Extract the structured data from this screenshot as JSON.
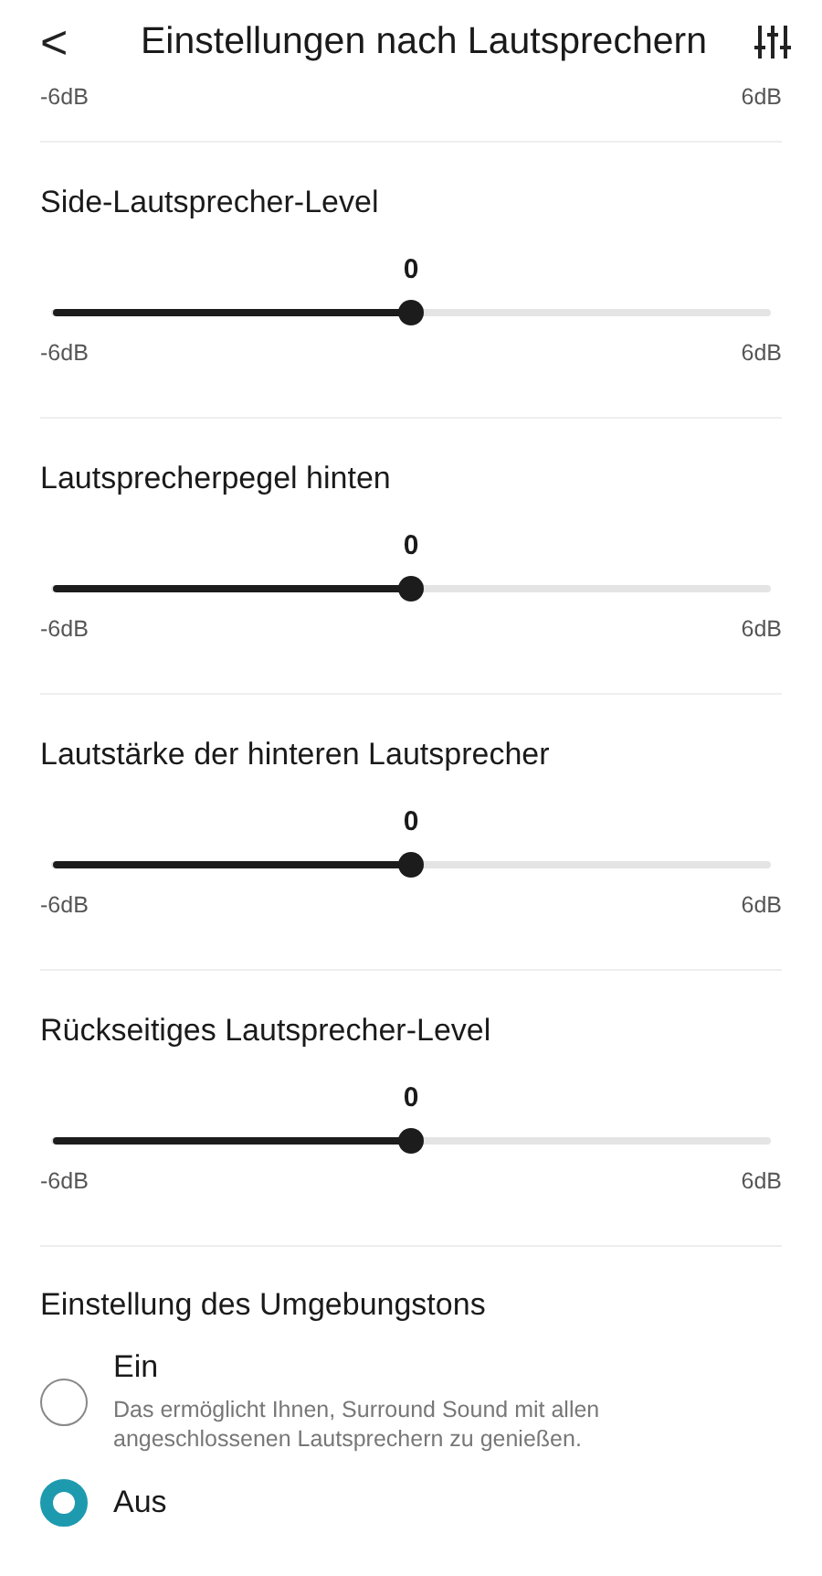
{
  "header": {
    "back": "<",
    "title": "Einstellungen nach Lautsprechern"
  },
  "top_slider_labels": {
    "min": "-6dB",
    "max": "6dB"
  },
  "sliders": [
    {
      "title": "Side-Lautsprecher-Level",
      "value": "0",
      "level": 0.5,
      "min": "-6dB",
      "max": "6dB"
    },
    {
      "title": "Lautsprecherpegel hinten",
      "value": "0",
      "level": 0.5,
      "min": "-6dB",
      "max": "6dB"
    },
    {
      "title": "Lautstärke der hinteren Lautsprecher",
      "value": "0",
      "level": 0.5,
      "min": "-6dB",
      "max": "6dB"
    },
    {
      "title": "Rückseitiges Lautsprecher-Level",
      "value": "0",
      "level": 0.5,
      "min": "-6dB",
      "max": "6dB"
    }
  ],
  "surround": {
    "title": "Einstellung des Umgebungstons",
    "options": [
      {
        "label": "Ein",
        "description": "Das ermöglicht Ihnen, Surround Sound mit allen angeschlossenen Lautsprechern zu genießen.",
        "selected": false
      },
      {
        "label": "Aus",
        "selected": true
      }
    ]
  }
}
